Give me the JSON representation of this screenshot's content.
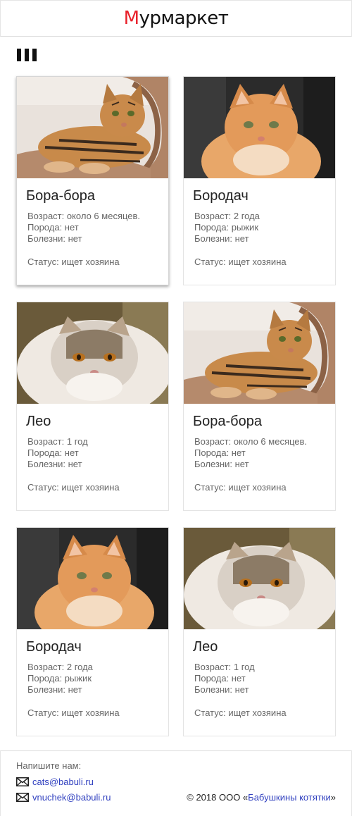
{
  "header": {
    "logo_first": "М",
    "logo_rest": "урмаркет"
  },
  "menu": {
    "icon": "menu-bars-icon"
  },
  "cats": [
    {
      "name": "Бора-бора",
      "age": "Возраст: около 6 месяцев.",
      "breed": "Порода: нет",
      "illness": "Болезни: нет",
      "status": "Статус: ищет хозяина",
      "photo": "tabby-cat-photo"
    },
    {
      "name": "Бородач",
      "age": "Возраст: 2 года",
      "breed": "Порода: рыжик",
      "illness": "Болезни: нет",
      "status": "Статус: ищет хозяина",
      "photo": "ginger-cat-photo"
    },
    {
      "name": "Лео",
      "age": "Возраст: 1 год",
      "breed": "Порода: нет",
      "illness": "Болезни: нет",
      "status": "Статус: ищет хозяина",
      "photo": "fluffy-cat-photo"
    },
    {
      "name": "Бора-бора",
      "age": "Возраст: около 6 месяцев.",
      "breed": "Порода: нет",
      "illness": "Болезни: нет",
      "status": "Статус: ищет хозяина",
      "photo": "tabby-cat-photo"
    },
    {
      "name": "Бородач",
      "age": "Возраст: 2 года",
      "breed": "Порода: рыжик",
      "illness": "Болезни: нет",
      "status": "Статус: ищет хозяина",
      "photo": "ginger-cat-photo"
    },
    {
      "name": "Лео",
      "age": "Возраст: 1 год",
      "breed": "Порода: нет",
      "illness": "Болезни: нет",
      "status": "Статус: ищет хозяина",
      "photo": "fluffy-cat-photo"
    }
  ],
  "footer": {
    "write_us": "Напишите нам:",
    "email_1": "cats@babuli.ru",
    "email_2": "vnuchek@babuli.ru",
    "copyright_prefix": "© 2018 ООО «",
    "company": "Бабушкины котятки",
    "copyright_suffix": "»"
  },
  "colors": {
    "logo_accent": "#e8212b",
    "link": "#2f3fbf",
    "muted_text": "#666666"
  }
}
